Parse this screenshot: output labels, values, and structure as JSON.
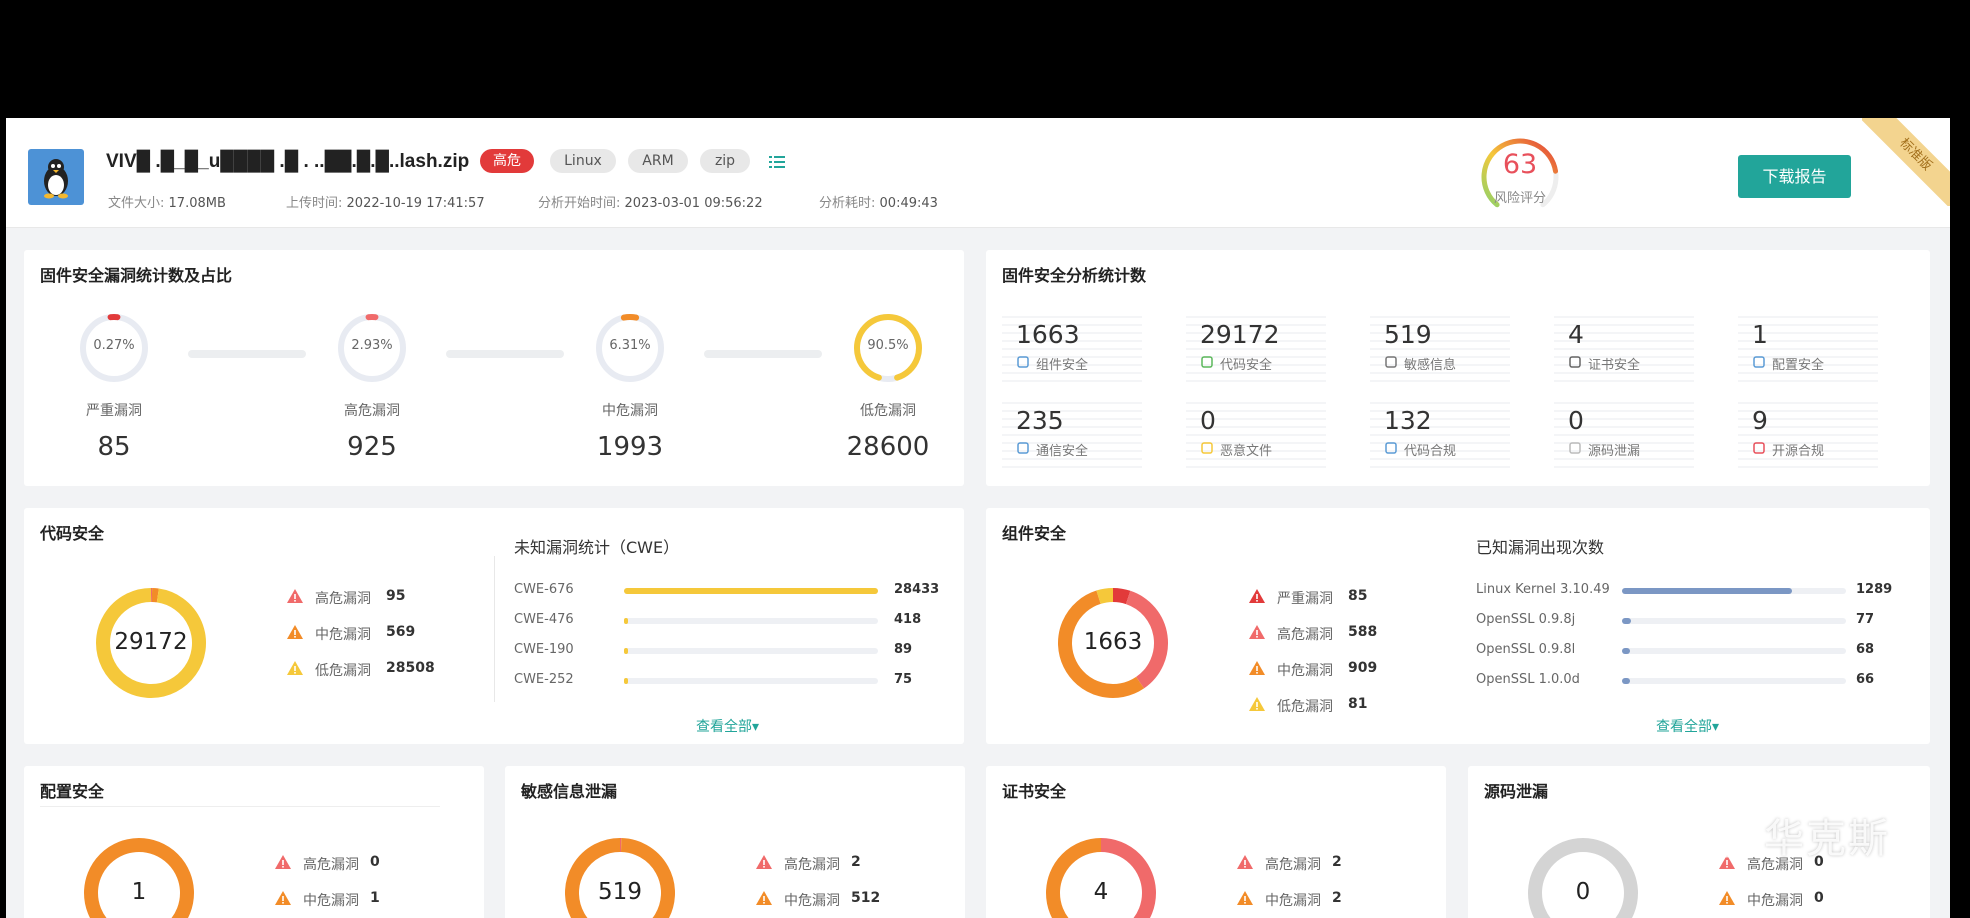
{
  "header": {
    "file_name": "VIV█ .█_█_u████ .█ . ..██.█.█..lash.zip",
    "tags": [
      "高危",
      "Linux",
      "ARM",
      "zip"
    ],
    "meta": {
      "file_size_label": "文件大小:",
      "file_size": "17.08MB",
      "upload_time_label": "上传时间:",
      "upload_time": "2022-10-19 17:41:57",
      "analysis_start_label": "分析开始时间:",
      "analysis_start": "2023-03-01 09:56:22",
      "analysis_duration_label": "分析耗时:",
      "analysis_duration": "00:49:43"
    },
    "risk_score": "63",
    "risk_score_label": "风险评分",
    "risk_score_value": 63,
    "download_button": "下载报告",
    "edition_ribbon": "标准版"
  },
  "vuln_stats": {
    "title": "固件安全漏洞统计数及占比",
    "items": [
      {
        "pct": "0.27%",
        "pct_value": 0.27,
        "label": "严重漏洞",
        "count": "85",
        "color": "#e23a3a"
      },
      {
        "pct": "2.93%",
        "pct_value": 2.93,
        "label": "高危漏洞",
        "count": "925",
        "color": "#f06a6a"
      },
      {
        "pct": "6.31%",
        "pct_value": 6.31,
        "label": "中危漏洞",
        "count": "1993",
        "color": "#f28c28"
      },
      {
        "pct": "90.5%",
        "pct_value": 90.5,
        "label": "低危漏洞",
        "count": "28600",
        "color": "#f5c83a"
      }
    ]
  },
  "analysis_stats": {
    "title": "固件安全分析统计数",
    "items": [
      {
        "value": "1663",
        "label": "组件安全",
        "icon": "component-icon"
      },
      {
        "value": "29172",
        "label": "代码安全",
        "icon": "shield-icon"
      },
      {
        "value": "519",
        "label": "敏感信息",
        "icon": "document-icon"
      },
      {
        "value": "4",
        "label": "证书安全",
        "icon": "certificate-icon"
      },
      {
        "value": "1",
        "label": "配置安全",
        "icon": "sliders-icon"
      },
      {
        "value": "235",
        "label": "通信安全",
        "icon": "signal-icon"
      },
      {
        "value": "0",
        "label": "恶意文件",
        "icon": "file-icon"
      },
      {
        "value": "132",
        "label": "代码合规",
        "icon": "hierarchy-icon"
      },
      {
        "value": "0",
        "label": "源码泄漏",
        "icon": "code-icon"
      },
      {
        "value": "9",
        "label": "开源合规",
        "icon": "open-source-icon"
      }
    ]
  },
  "code_security": {
    "title": "代码安全",
    "total": "29172",
    "legend": [
      {
        "label": "高危漏洞",
        "value": "95",
        "color": "#f06a6a"
      },
      {
        "label": "中危漏洞",
        "value": "569",
        "color": "#f28c28"
      },
      {
        "label": "低危漏洞",
        "value": "28508",
        "color": "#f5c83a"
      }
    ],
    "cwe_title": "未知漏洞统计（CWE）",
    "cwe_rows": [
      {
        "label": "CWE-676",
        "value": "28433",
        "fraction": 1.0
      },
      {
        "label": "CWE-476",
        "value": "418",
        "fraction": 0.015
      },
      {
        "label": "CWE-190",
        "value": "89",
        "fraction": 0.003
      },
      {
        "label": "CWE-252",
        "value": "75",
        "fraction": 0.003
      }
    ],
    "view_all": "查看全部▾"
  },
  "component_security": {
    "title": "组件安全",
    "total": "1663",
    "legend": [
      {
        "label": "严重漏洞",
        "value": "85",
        "color": "#e23a3a"
      },
      {
        "label": "高危漏洞",
        "value": "588",
        "color": "#f06a6a"
      },
      {
        "label": "中危漏洞",
        "value": "909",
        "color": "#f28c28"
      },
      {
        "label": "低危漏洞",
        "value": "81",
        "color": "#f5c83a"
      }
    ],
    "known_title": "已知漏洞出现次数",
    "known_rows": [
      {
        "label": "Linux Kernel 3.10.49",
        "value": "1289",
        "fraction": 0.76
      },
      {
        "label": "OpenSSL 0.9.8j",
        "value": "77",
        "fraction": 0.04
      },
      {
        "label": "OpenSSL 0.9.8l",
        "value": "68",
        "fraction": 0.035
      },
      {
        "label": "OpenSSL 1.0.0d",
        "value": "66",
        "fraction": 0.035
      }
    ],
    "view_all": "查看全部▾"
  },
  "config_security": {
    "title": "配置安全",
    "total": "1",
    "legend": [
      {
        "label": "高危漏洞",
        "value": "0",
        "color": "#f06a6a"
      },
      {
        "label": "中危漏洞",
        "value": "1",
        "color": "#f28c28"
      }
    ]
  },
  "sensitive_leak": {
    "title": "敏感信息泄漏",
    "total": "519",
    "legend": [
      {
        "label": "高危漏洞",
        "value": "2",
        "color": "#f06a6a"
      },
      {
        "label": "中危漏洞",
        "value": "512",
        "color": "#f28c28"
      }
    ]
  },
  "cert_security": {
    "title": "证书安全",
    "total": "4",
    "legend": [
      {
        "label": "高危漏洞",
        "value": "2",
        "color": "#f06a6a"
      },
      {
        "label": "中危漏洞",
        "value": "2",
        "color": "#f28c28"
      }
    ]
  },
  "source_leak": {
    "title": "源码泄漏",
    "total": "0",
    "legend": [
      {
        "label": "高危漏洞",
        "value": "0",
        "color": "#f06a6a"
      },
      {
        "label": "中危漏洞",
        "value": "0",
        "color": "#f28c28"
      }
    ]
  },
  "watermark": {
    "text": "华克斯",
    "icon": "wechat-icon"
  },
  "colors": {
    "accent": "#22a59a",
    "critical": "#e23a3a",
    "high": "#f06a6a",
    "medium": "#f28c28",
    "low": "#f5c83a"
  }
}
